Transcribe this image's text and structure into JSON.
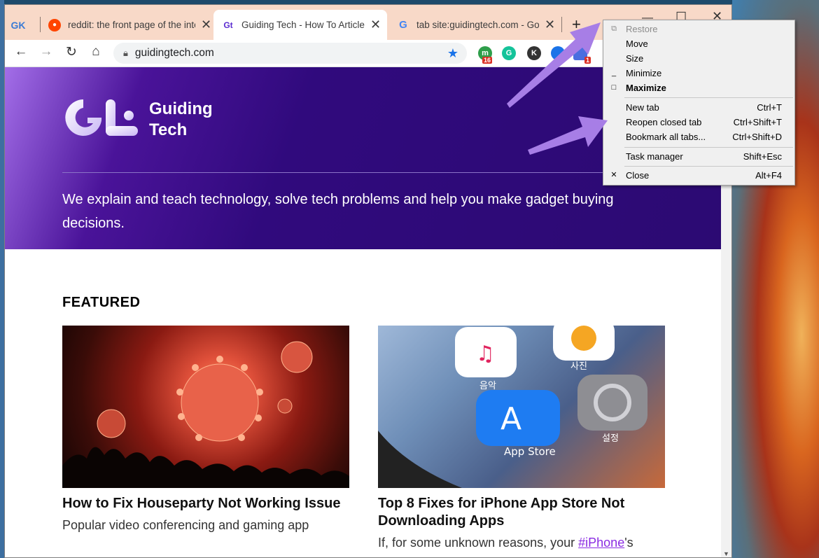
{
  "tabs": [
    {
      "favicon": "gk-icon",
      "title": "",
      "active": false
    },
    {
      "favicon": "reddit-icon",
      "title": "reddit: the front page of the internet",
      "active": false
    },
    {
      "favicon": "guiding-tech-icon",
      "title": "Guiding Tech - How To Articles",
      "active": true
    },
    {
      "favicon": "google-icon",
      "title": "tab site:guidingtech.com - Google",
      "active": false
    }
  ],
  "gk_label": "GK",
  "toolbar": {
    "url": "guidingtech.com",
    "badge_one": "16",
    "badge_two": "1",
    "ext_k": "K"
  },
  "hero": {
    "brand_line1": "Guiding",
    "brand_line2": "Tech",
    "tagline": "We explain and teach technology, solve tech problems and help you make gadget buying decisions."
  },
  "featured_heading": "FEATURED",
  "cards": [
    {
      "title": "How to Fix Houseparty Not Working Issue",
      "desc": "Popular video conferencing and gaming app"
    },
    {
      "title": "Top 8 Fixes for iPhone App Store Not Downloading Apps",
      "desc_prefix": "If, for some unknown reasons, your ",
      "desc_tag": "#iPhone",
      "desc_suffix": "'s"
    }
  ],
  "card2_img_labels": {
    "music": "음악",
    "photos": "사진",
    "appstore": "App Store",
    "settings": "설정"
  },
  "context_menu": {
    "items": [
      {
        "label": "Restore",
        "shortcut": "",
        "icon": "restore-icon",
        "disabled": true,
        "bold": false
      },
      {
        "label": "Move",
        "shortcut": "",
        "icon": "",
        "disabled": false,
        "bold": false
      },
      {
        "label": "Size",
        "shortcut": "",
        "icon": "",
        "disabled": false,
        "bold": false
      },
      {
        "label": "Minimize",
        "shortcut": "",
        "icon": "minimize-icon",
        "disabled": false,
        "bold": false
      },
      {
        "label": "Maximize",
        "shortcut": "",
        "icon": "maximize-icon",
        "disabled": false,
        "bold": true
      },
      {
        "label": "New tab",
        "shortcut": "Ctrl+T",
        "icon": "",
        "disabled": false,
        "bold": false
      },
      {
        "label": "Reopen closed tab",
        "shortcut": "Ctrl+Shift+T",
        "icon": "",
        "disabled": false,
        "bold": false
      },
      {
        "label": "Bookmark all tabs...",
        "shortcut": "Ctrl+Shift+D",
        "icon": "",
        "disabled": false,
        "bold": false
      },
      {
        "label": "Task manager",
        "shortcut": "Shift+Esc",
        "icon": "",
        "disabled": false,
        "bold": false
      },
      {
        "label": "Close",
        "shortcut": "Alt+F4",
        "icon": "close-icon",
        "disabled": false,
        "bold": false
      }
    ]
  },
  "colors": {
    "tabstrip": "#f8d9c8",
    "hero": "#300a7d",
    "accent": "#1a73e8",
    "annotation_arrow": "#a77ee6"
  }
}
